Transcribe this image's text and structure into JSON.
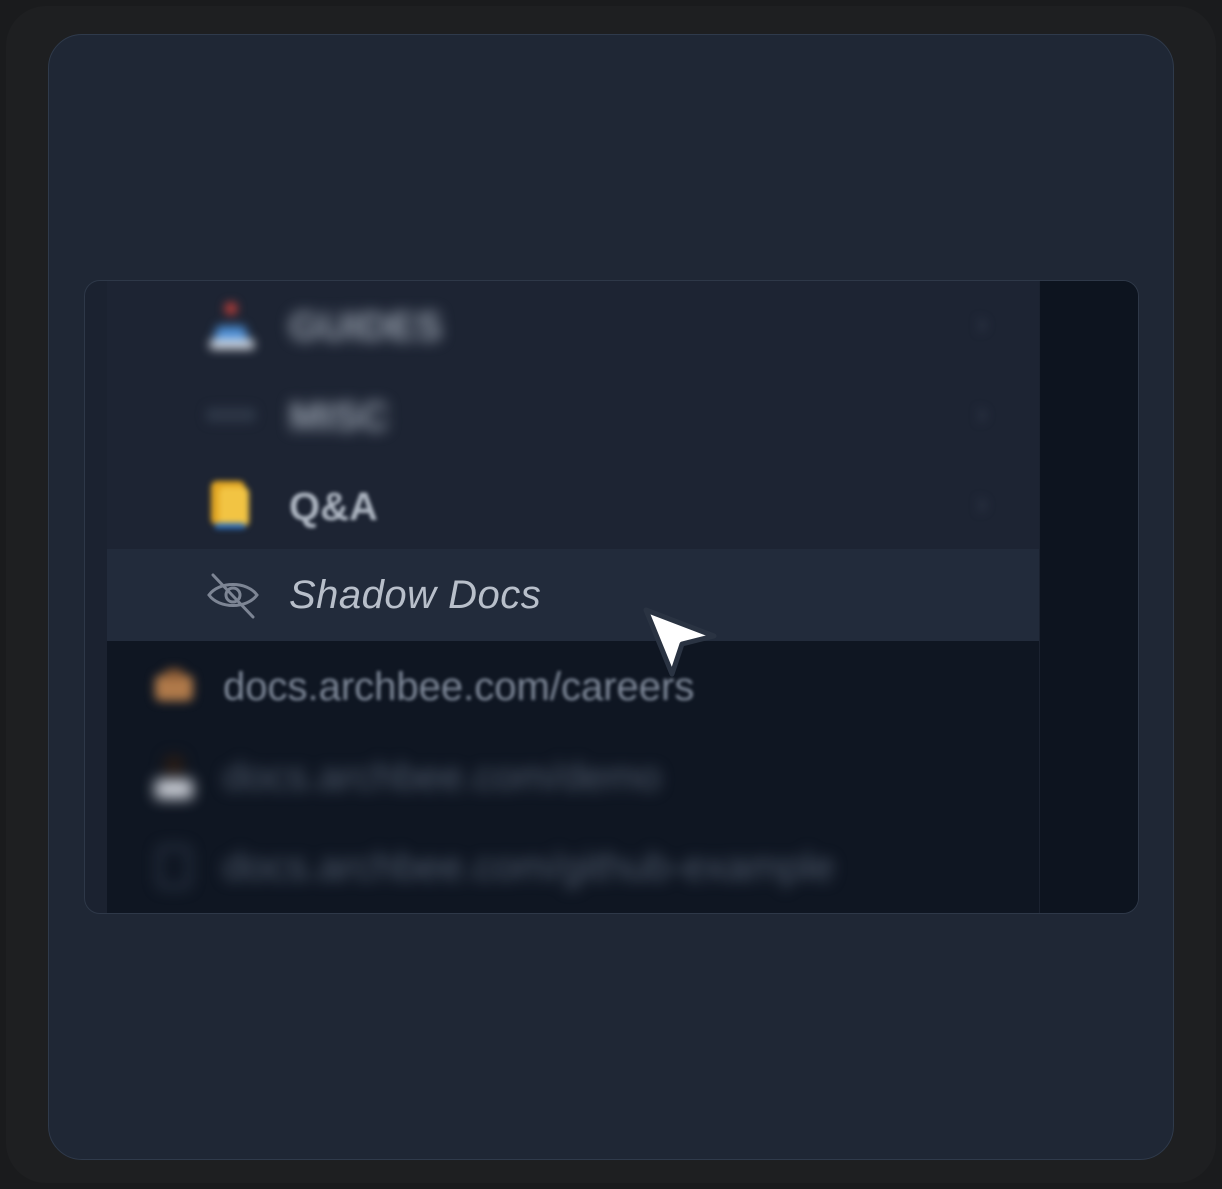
{
  "menu": {
    "items": [
      {
        "label": "GUIDES",
        "icon": "guides-emoji-icon",
        "chevron": "›"
      },
      {
        "label": "MISC",
        "icon": "misc-emoji-icon",
        "chevron": "›"
      },
      {
        "label": "Q&A",
        "icon": "qa-emoji-icon",
        "chevron": "›"
      }
    ],
    "shadow_docs": {
      "label": "Shadow Docs",
      "icon": "eye-slash-icon"
    }
  },
  "links": [
    {
      "label": "docs.archbee.com/careers",
      "icon": "careers-emoji-icon"
    },
    {
      "label": "docs.archbee.com/demo",
      "icon": "demo-emoji-icon"
    },
    {
      "label": "docs.archbee.com/github-example",
      "icon": "github-icon"
    }
  ],
  "colors": {
    "page": "#1a1b1d",
    "card": "#1f2735",
    "panel": "#1b2230",
    "menu": "#1d2433",
    "highlight": "#222b3b",
    "lower": "#0f1622",
    "strip": "#0d141f"
  }
}
